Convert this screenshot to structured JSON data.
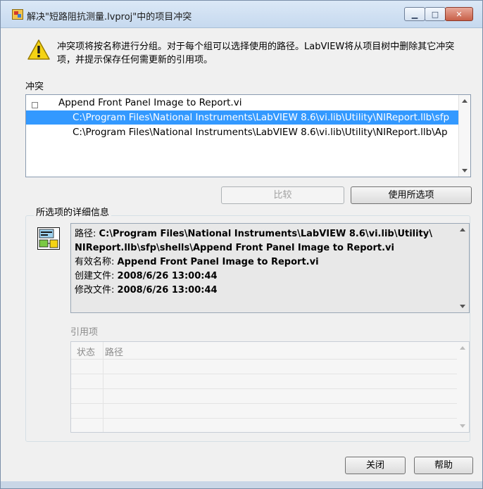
{
  "window": {
    "title": "解决\"短路阻抗测量.lvproj\"中的项目冲突",
    "controls": {
      "minimize": "▁",
      "maximize": "□",
      "close": "✕"
    }
  },
  "message": "冲突项将按名称进行分组。对于每个组可以选择使用的路径。LabVIEW将从项目树中删除其它冲突项，并提示保存任何需更新的引用项。",
  "conflicts": {
    "label": "冲突",
    "group_name": "Append Front Panel Image to Report.vi",
    "expander": "⊟",
    "items": [
      {
        "path": "C:\\Program Files\\National Instruments\\LabVIEW 8.6\\vi.lib\\Utility\\NIReport.llb\\sfp",
        "selected": true
      },
      {
        "path": "C:\\Program Files\\National Instruments\\LabVIEW 8.6\\vi.lib\\Utility\\NIReport.llb\\Ap",
        "selected": false
      }
    ]
  },
  "buttons": {
    "compare": "比较",
    "use_selected": "使用所选项",
    "close": "关闭",
    "help": "帮助"
  },
  "details": {
    "group_title": "所选项的详细信息",
    "path_label": "路径:",
    "path_line1": "C:\\Program Files\\National Instruments\\LabVIEW 8.6\\vi.lib\\Utility\\",
    "path_line2": "NIReport.llb\\sfp\\shells\\Append Front Panel Image to Report.vi",
    "name_label": "有效名称:",
    "name_value": "Append Front Panel Image to Report.vi",
    "created_label": "创建文件:",
    "created_value": "2008/6/26 13:00:44",
    "modified_label": "修改文件:",
    "modified_value": "2008/6/26 13:00:44"
  },
  "references": {
    "label": "引用项",
    "columns": [
      "状态",
      "路径"
    ]
  },
  "colors": {
    "selection": "#3399ff",
    "dialog_bg": "#f0f0f0",
    "title_bar": "#c6d9ef"
  }
}
